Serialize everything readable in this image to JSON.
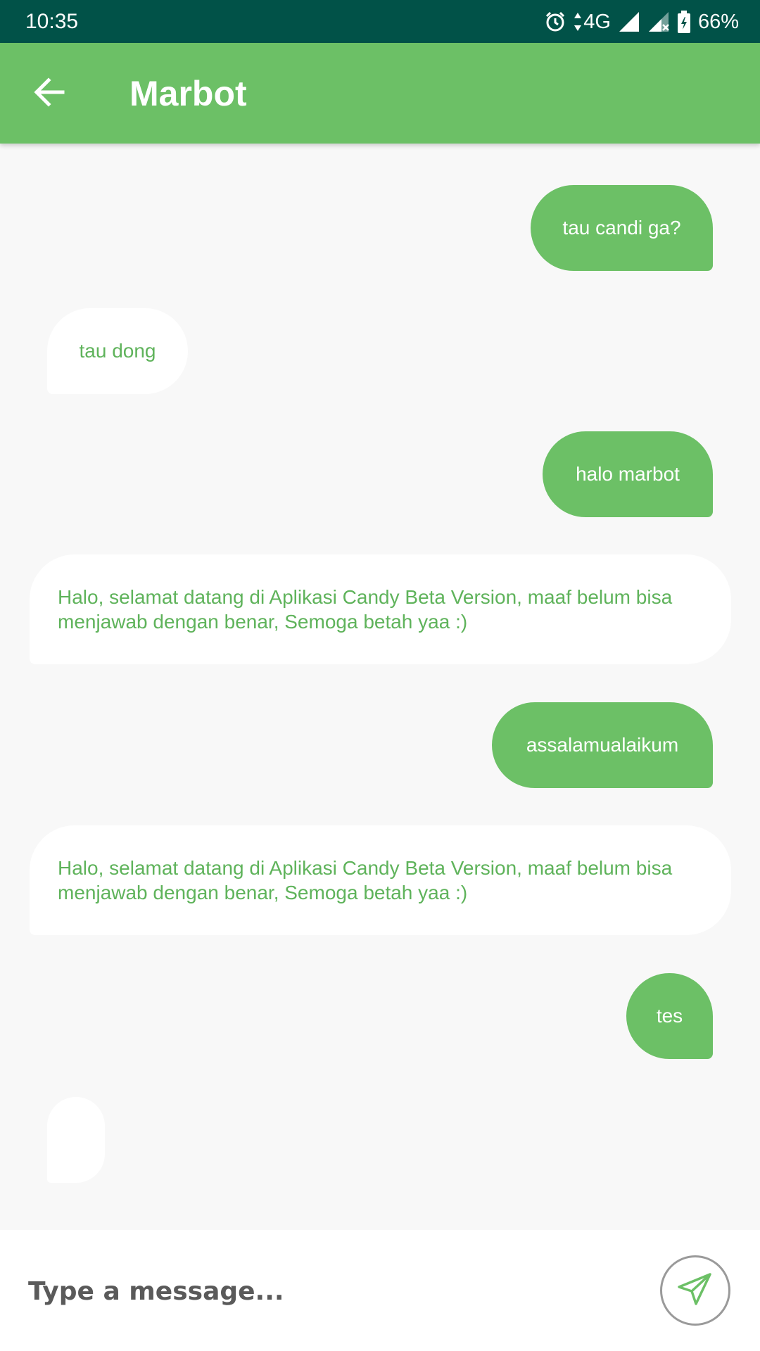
{
  "status_bar": {
    "time": "10:35",
    "network": "4G",
    "battery": "66%",
    "icons": [
      "alarm-icon",
      "data-arrows-icon",
      "signal-icon",
      "signal-no-data-icon",
      "battery-charging-icon"
    ]
  },
  "app_bar": {
    "title": "Marbot",
    "back_icon": "arrow-back-icon",
    "color": "#6cc066"
  },
  "messages": [
    {
      "sender": "user",
      "text": "tau candi ga?"
    },
    {
      "sender": "bot",
      "text": "tau dong"
    },
    {
      "sender": "user",
      "text": "halo marbot"
    },
    {
      "sender": "bot",
      "text": "Halo, selamat datang di Aplikasi Candy Beta Version, maaf belum bisa menjawab dengan benar, Semoga betah yaa :)"
    },
    {
      "sender": "user",
      "text": "assalamualaikum"
    },
    {
      "sender": "bot",
      "text": "Halo, selamat datang di Aplikasi Candy Beta Version, maaf belum bisa menjawab dengan benar, Semoga betah yaa :)"
    },
    {
      "sender": "user",
      "text": "tes"
    },
    {
      "sender": "bot",
      "text": ""
    }
  ],
  "composer": {
    "placeholder": "Type a message...",
    "send_icon": "send-icon"
  },
  "colors": {
    "status_bar": "#015248",
    "accent": "#6cc066",
    "bot_text": "#5fb35b",
    "background": "#f8f8f8"
  }
}
